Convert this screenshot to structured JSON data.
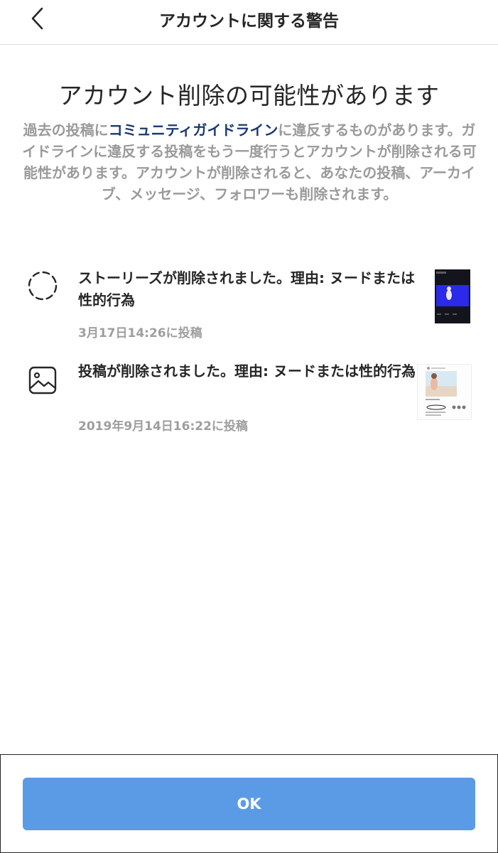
{
  "nav": {
    "title": "アカウントに関する警告",
    "back_icon": "chevron-left-icon"
  },
  "warning": {
    "headline": "アカウント削除の可能性があります",
    "desc_before": "過去の投稿に",
    "desc_link": "コミュニティガイドライン",
    "desc_after": "に違反するものがあります。ガイドラインに違反する投稿をもう一度行うとアカウントが削除される可能性があります。アカウントが削除されると、あなたの投稿、アーカイブ、メッセージ、フォロワーも削除されます。"
  },
  "items": [
    {
      "icon": "story-dashed-circle-icon",
      "title": "ストーリーズが削除されました。理由: ヌードまたは性的行為",
      "meta": "3月17日14:26に投稿"
    },
    {
      "icon": "image-icon",
      "title": "投稿が削除されました。理由: ヌードまたは性的行為",
      "meta": "2019年9月14日16:22に投稿"
    }
  ],
  "footer": {
    "ok_label": "OK"
  },
  "colors": {
    "accent_button": "#5b9be6",
    "link": "#1b3a6e",
    "muted_text": "#9a9a9a"
  }
}
